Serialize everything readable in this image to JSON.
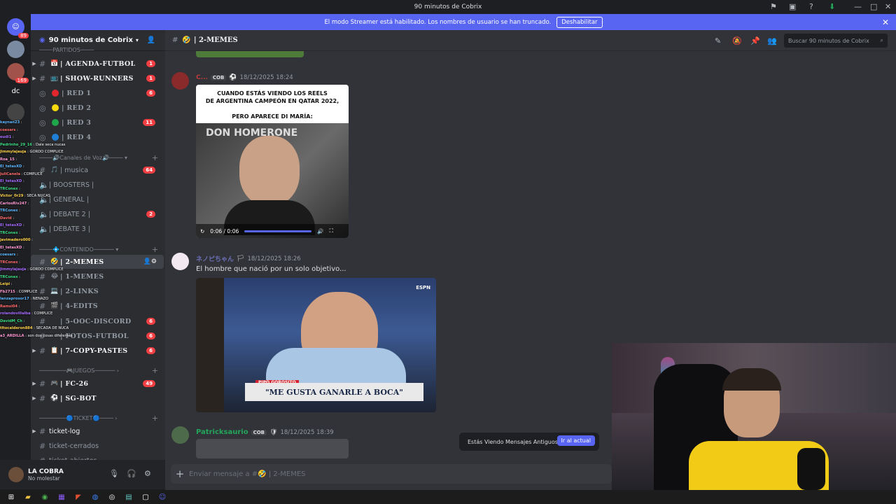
{
  "window": {
    "title": "90 minutos de Cobrix"
  },
  "banner": {
    "text": "El modo Streamer está habilitado. Los nombres de usuario se han truncado.",
    "button": "Deshabilitar"
  },
  "servers": [
    {
      "label": "",
      "badge": "89"
    },
    {
      "label": "",
      "badge": ""
    },
    {
      "label": "",
      "badge": "169"
    },
    {
      "label": "dc",
      "badge": ""
    },
    {
      "label": "",
      "badge": ""
    }
  ],
  "guild": {
    "name": "90 minutos de Cobrix"
  },
  "categories": {
    "partidos": "PARTIDOS",
    "voz": "Canales de Voz",
    "contenido": "CONTENIDO",
    "juegos": "JUEGOS",
    "ticket": "TICKET"
  },
  "channels": [
    {
      "emoji": "📅",
      "name": "| AGENDA-FUTBOL",
      "badge": "1"
    },
    {
      "emoji": "📺",
      "name": "| SHOW-RUNNERS",
      "badge": "1"
    },
    {
      "emoji": "🔴",
      "name": "| RED 1",
      "badge": "6"
    },
    {
      "emoji": "🟡",
      "name": "| RED 2",
      "badge": ""
    },
    {
      "emoji": "🟢",
      "name": "| RED 3",
      "badge": "11"
    },
    {
      "emoji": "🔵",
      "name": "| RED 4",
      "badge": ""
    },
    {
      "emoji": "🎵",
      "name": "| musica",
      "badge": "64"
    },
    {
      "emoji": "",
      "name": "| BOOSTERS |",
      "badge": ""
    },
    {
      "emoji": "",
      "name": "| GENERAL |",
      "badge": ""
    },
    {
      "emoji": "",
      "name": "| DEBATE 2 |",
      "badge": "2"
    },
    {
      "emoji": "",
      "name": "| DEBATE 3 |",
      "badge": ""
    },
    {
      "emoji": "🤣",
      "name": "| 2-MEMES",
      "badge": ""
    },
    {
      "emoji": "😂",
      "name": "| 1-MEMES",
      "badge": ""
    },
    {
      "emoji": "💻",
      "name": "| 2-LINKS",
      "badge": ""
    },
    {
      "emoji": "🎬",
      "name": "| 4-EDITS",
      "badge": ""
    },
    {
      "emoji": "",
      "name": "| 5-OOC-DISCORD",
      "badge": "6"
    },
    {
      "emoji": "",
      "name": "| FOTOS-FUTBOL",
      "badge": "6"
    },
    {
      "emoji": "📋",
      "name": "| 7-COPY-PASTES",
      "badge": "6"
    },
    {
      "emoji": "🎮",
      "name": "| FC-26",
      "badge": "49"
    },
    {
      "emoji": "⚽",
      "name": "| SG-BOT",
      "badge": ""
    },
    {
      "emoji": "",
      "name": "ticket-log",
      "badge": ""
    },
    {
      "emoji": "",
      "name": "ticket-cerrados",
      "badge": ""
    },
    {
      "emoji": "",
      "name": "ticket-abiertos",
      "badge": ""
    }
  ],
  "user": {
    "name": "LA COBRA",
    "status": "No molestar"
  },
  "chat": {
    "channel": "| 2-MEMES",
    "search_placeholder": "Buscar 90 minutos de Cobrix",
    "messages": [
      {
        "author": "C...",
        "tag": "COB",
        "time": "18/12/2025 18:24",
        "text": ""
      },
      {
        "author": "ネノピちゃん",
        "tag": "",
        "time": "18/12/2025 18:26",
        "text": "El hombre que nació por un solo objetivo..."
      },
      {
        "author": "Patricksaurio",
        "tag": "COB",
        "time": "18/12/2025 18:39",
        "text": ""
      }
    ],
    "meme_caption": "CUANDO ESTÁS VIENDO LOS REELS\nDE ARGENTINA CAMPEÓN EN QATAR 2022,\n\nPERO APARECE DI MARÍA:",
    "meme_watermark": "DON HOMERONE",
    "video_time": "0:06 / 0:06",
    "tv_caption": "\"ME GUSTA GANARLE A BOCA\"",
    "tv_label": "PIPO GOROSITO",
    "tv_network": "ESPN",
    "toast_text": "Estás Viendo Mensajes Antiguos",
    "toast_button": "Ir al actual",
    "composer_placeholder": "Enviar mensaje a #🤣 | 2-MEMES"
  },
  "stream_chat": [
    {
      "user": "kaynan23",
      "msg": ":"
    },
    {
      "user": "coesars",
      "msg": ":"
    },
    {
      "user": "eudi1",
      "msg": ":"
    },
    {
      "user": "Pedrinho_29_16",
      "msg": ": Dale seca nucas"
    },
    {
      "user": "Jimmylajauja",
      "msg": ": GORDO COMPLICE"
    },
    {
      "user": "Roa_15",
      "msg": ":"
    },
    {
      "user": "El_tetasXD",
      "msg": ":"
    },
    {
      "user": "JuliCanela",
      "msg": ": COMPLICE"
    },
    {
      "user": "El_tetasXD",
      "msg": ":"
    },
    {
      "user": "TRConex",
      "msg": ":"
    },
    {
      "user": "Victor_0r29",
      "msg": ": SECA NUCAS"
    },
    {
      "user": "CarlosRiv247",
      "msg": ":"
    },
    {
      "user": "TRConex",
      "msg": ":"
    },
    {
      "user": "David",
      "msg": ":"
    },
    {
      "user": "El_tetasXD",
      "msg": ":"
    },
    {
      "user": "TRConex",
      "msg": ":"
    },
    {
      "user": "javimadero000",
      "msg": ":"
    },
    {
      "user": "El_tetasXD",
      "msg": ":"
    },
    {
      "user": "coesars",
      "msg": ":"
    },
    {
      "user": "TRConex",
      "msg": ":"
    },
    {
      "user": "Jimmylajauja",
      "msg": ": GORDO COMPLICE"
    },
    {
      "user": "TRConex",
      "msg": ":"
    },
    {
      "user": "Leipi",
      "msg": ":"
    },
    {
      "user": "Fb2715",
      "msg": ": COMPLICE"
    },
    {
      "user": "lanzaprosor17",
      "msg": ": NENAZO"
    },
    {
      "user": "Ramsi04",
      "msg": ":"
    },
    {
      "user": "rolandovillalba",
      "msg": ": COMPLICE"
    },
    {
      "user": "DavidM_Ch",
      "msg": ":"
    },
    {
      "user": "tltocalderon884",
      "msg": ": SECADA DE NUCA"
    },
    {
      "user": "a3_ARDILLA",
      "msg": ": son dos cosas diferentes"
    }
  ],
  "colors": {
    "accent": "#5865f2",
    "badge": "#f23f43",
    "online_green": "#23a55a"
  }
}
